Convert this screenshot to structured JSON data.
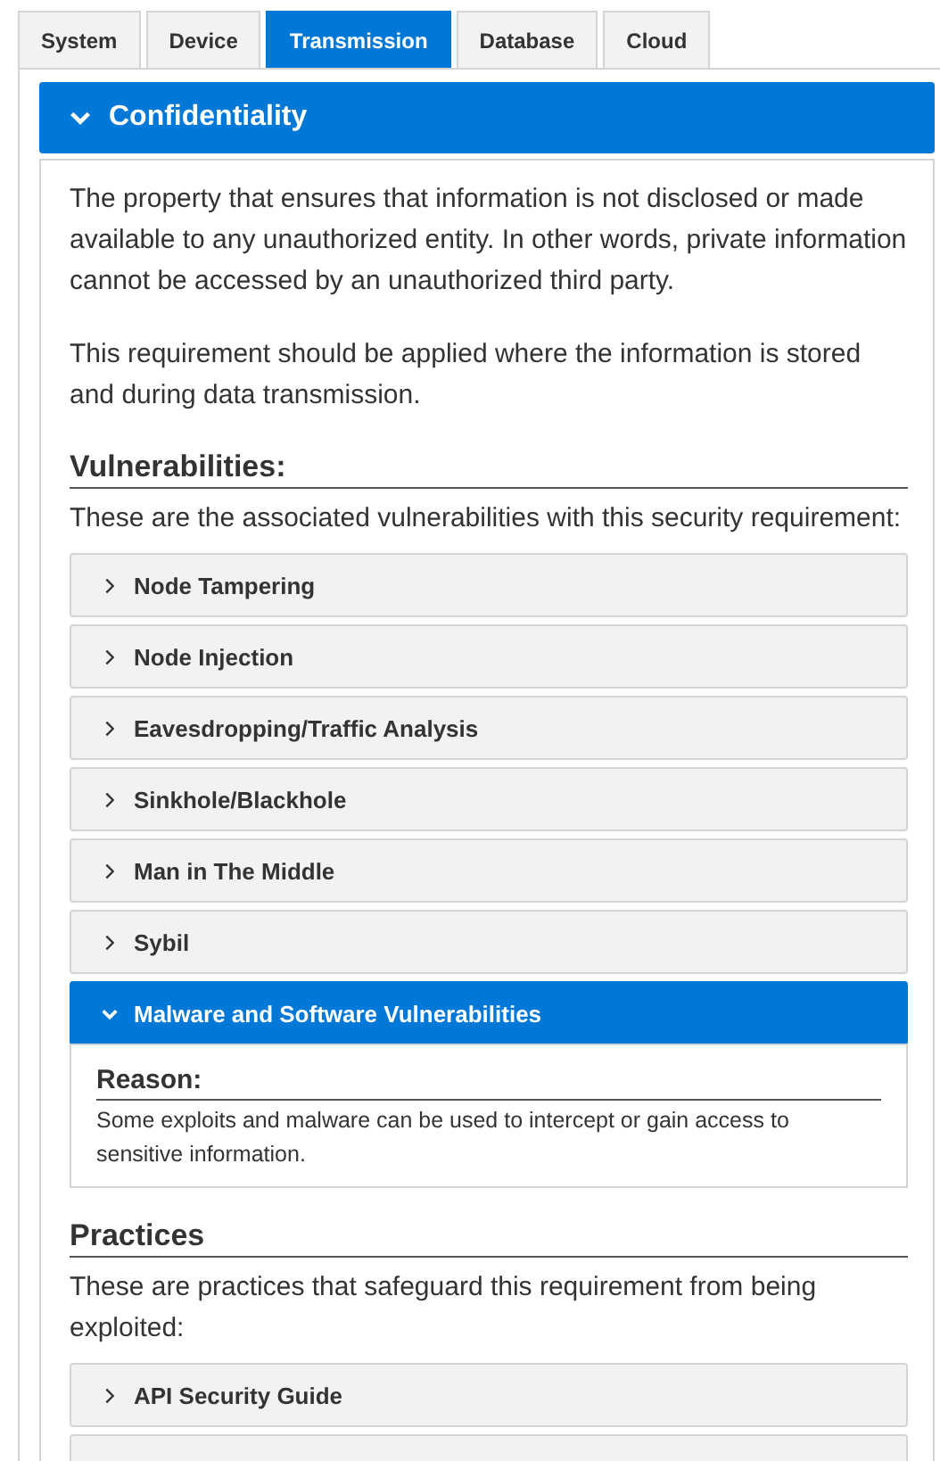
{
  "tabs": [
    {
      "label": "System",
      "selected": false
    },
    {
      "label": "Device",
      "selected": false
    },
    {
      "label": "Transmission",
      "selected": true
    },
    {
      "label": "Database",
      "selected": false
    },
    {
      "label": "Cloud",
      "selected": false
    }
  ],
  "requirement": {
    "title": "Confidentiality",
    "expanded": true,
    "paragraphs": [
      "The property that ensures that information is not disclosed or made available to any unauthorized entity. In other words, private information cannot be accessed by an unauthorized third party.",
      "This requirement should be applied where the information is stored and during data transmission."
    ],
    "sections": [
      {
        "heading": "Vulnerabilities:",
        "intro": "These are the associated vulnerabilities with this security requirement:",
        "items": [
          {
            "label": "Node Tampering",
            "expanded": false
          },
          {
            "label": "Node Injection",
            "expanded": false
          },
          {
            "label": "Eavesdropping/Traffic Analysis",
            "expanded": false
          },
          {
            "label": "Sinkhole/Blackhole",
            "expanded": false
          },
          {
            "label": "Man in The Middle",
            "expanded": false
          },
          {
            "label": "Sybil",
            "expanded": false
          },
          {
            "label": "Malware and Software Vulnerabilities",
            "expanded": true,
            "reason_heading": "Reason:",
            "reason": "Some exploits and malware can be used to intercept or gain access to sensitive information."
          }
        ]
      },
      {
        "heading": "Practices",
        "intro": "These are practices that safeguard this requirement from being exploited:",
        "items": [
          {
            "label": "API Security Guide",
            "expanded": false
          },
          {
            "expanded": false
          }
        ]
      }
    ]
  }
}
